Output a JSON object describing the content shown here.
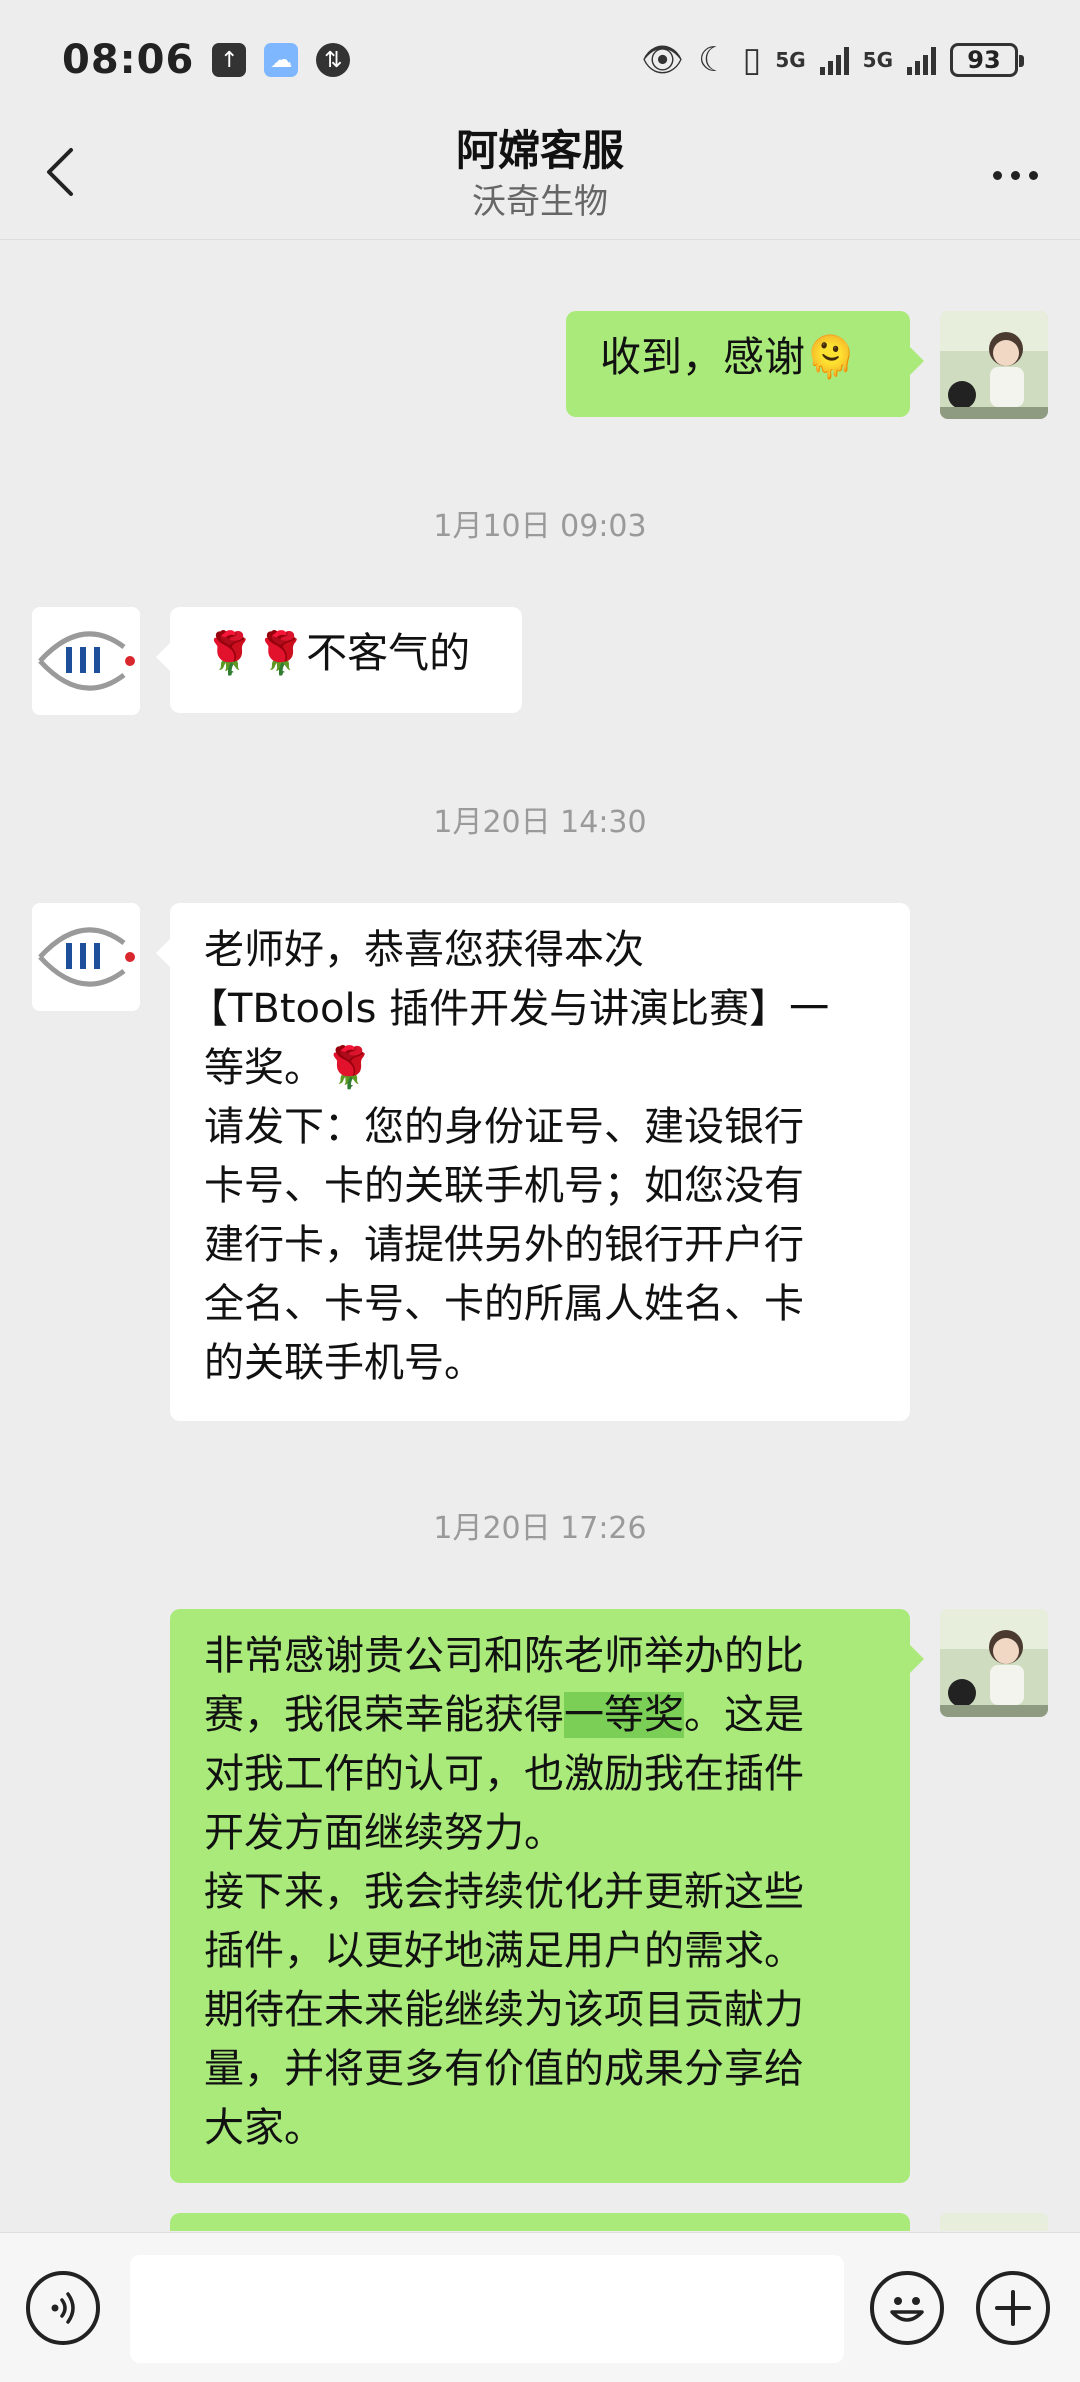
{
  "status_bar": {
    "time": "08:06",
    "signal1": "5G",
    "signal2": "5G",
    "battery": "93"
  },
  "header": {
    "title": "阿嫦客服",
    "subtitle": "沃奇生物"
  },
  "messages": {
    "m1": {
      "text": "收到，感谢🫠"
    },
    "ts1": "1月10日 09:03",
    "m2": {
      "text": "🌹🌹不客气的"
    },
    "ts2": "1月20日 14:30",
    "m3": {
      "lines": [
        "老师好，恭喜您获得本次",
        "【TBtools 插件开发与讲演比赛】一",
        "等奖。🌹",
        "请发下：您的身份证号、建设银行",
        "卡号、卡的关联手机号；如您没有",
        "建行卡，请提供另外的银行开户行",
        "全名、卡号、卡的所属人姓名、卡",
        "的关联手机号。"
      ]
    },
    "ts3": "1月20日 17:26",
    "m4": {
      "line1": "非常感谢贵公司和陈老师举办的比",
      "line2_pre": "赛，我很荣幸能获得",
      "line2_hl": "一等奖",
      "line2_post": "。这是",
      "lines_rest": [
        "对我工作的认可，也激励我在插件",
        "开发方面继续努力。",
        "接下来，我会持续优化并更新这些",
        "插件，以更好地满足用户的需求。",
        "期待在未来能继续为该项目贡献力",
        "量，并将更多有价值的成果分享给",
        "大家。"
      ]
    }
  },
  "input": {
    "value": ""
  },
  "colors": {
    "background": "#ededed",
    "bubble_out": "#a9ea7a",
    "bubble_in": "#ffffff",
    "highlight": "#7ccf56"
  }
}
